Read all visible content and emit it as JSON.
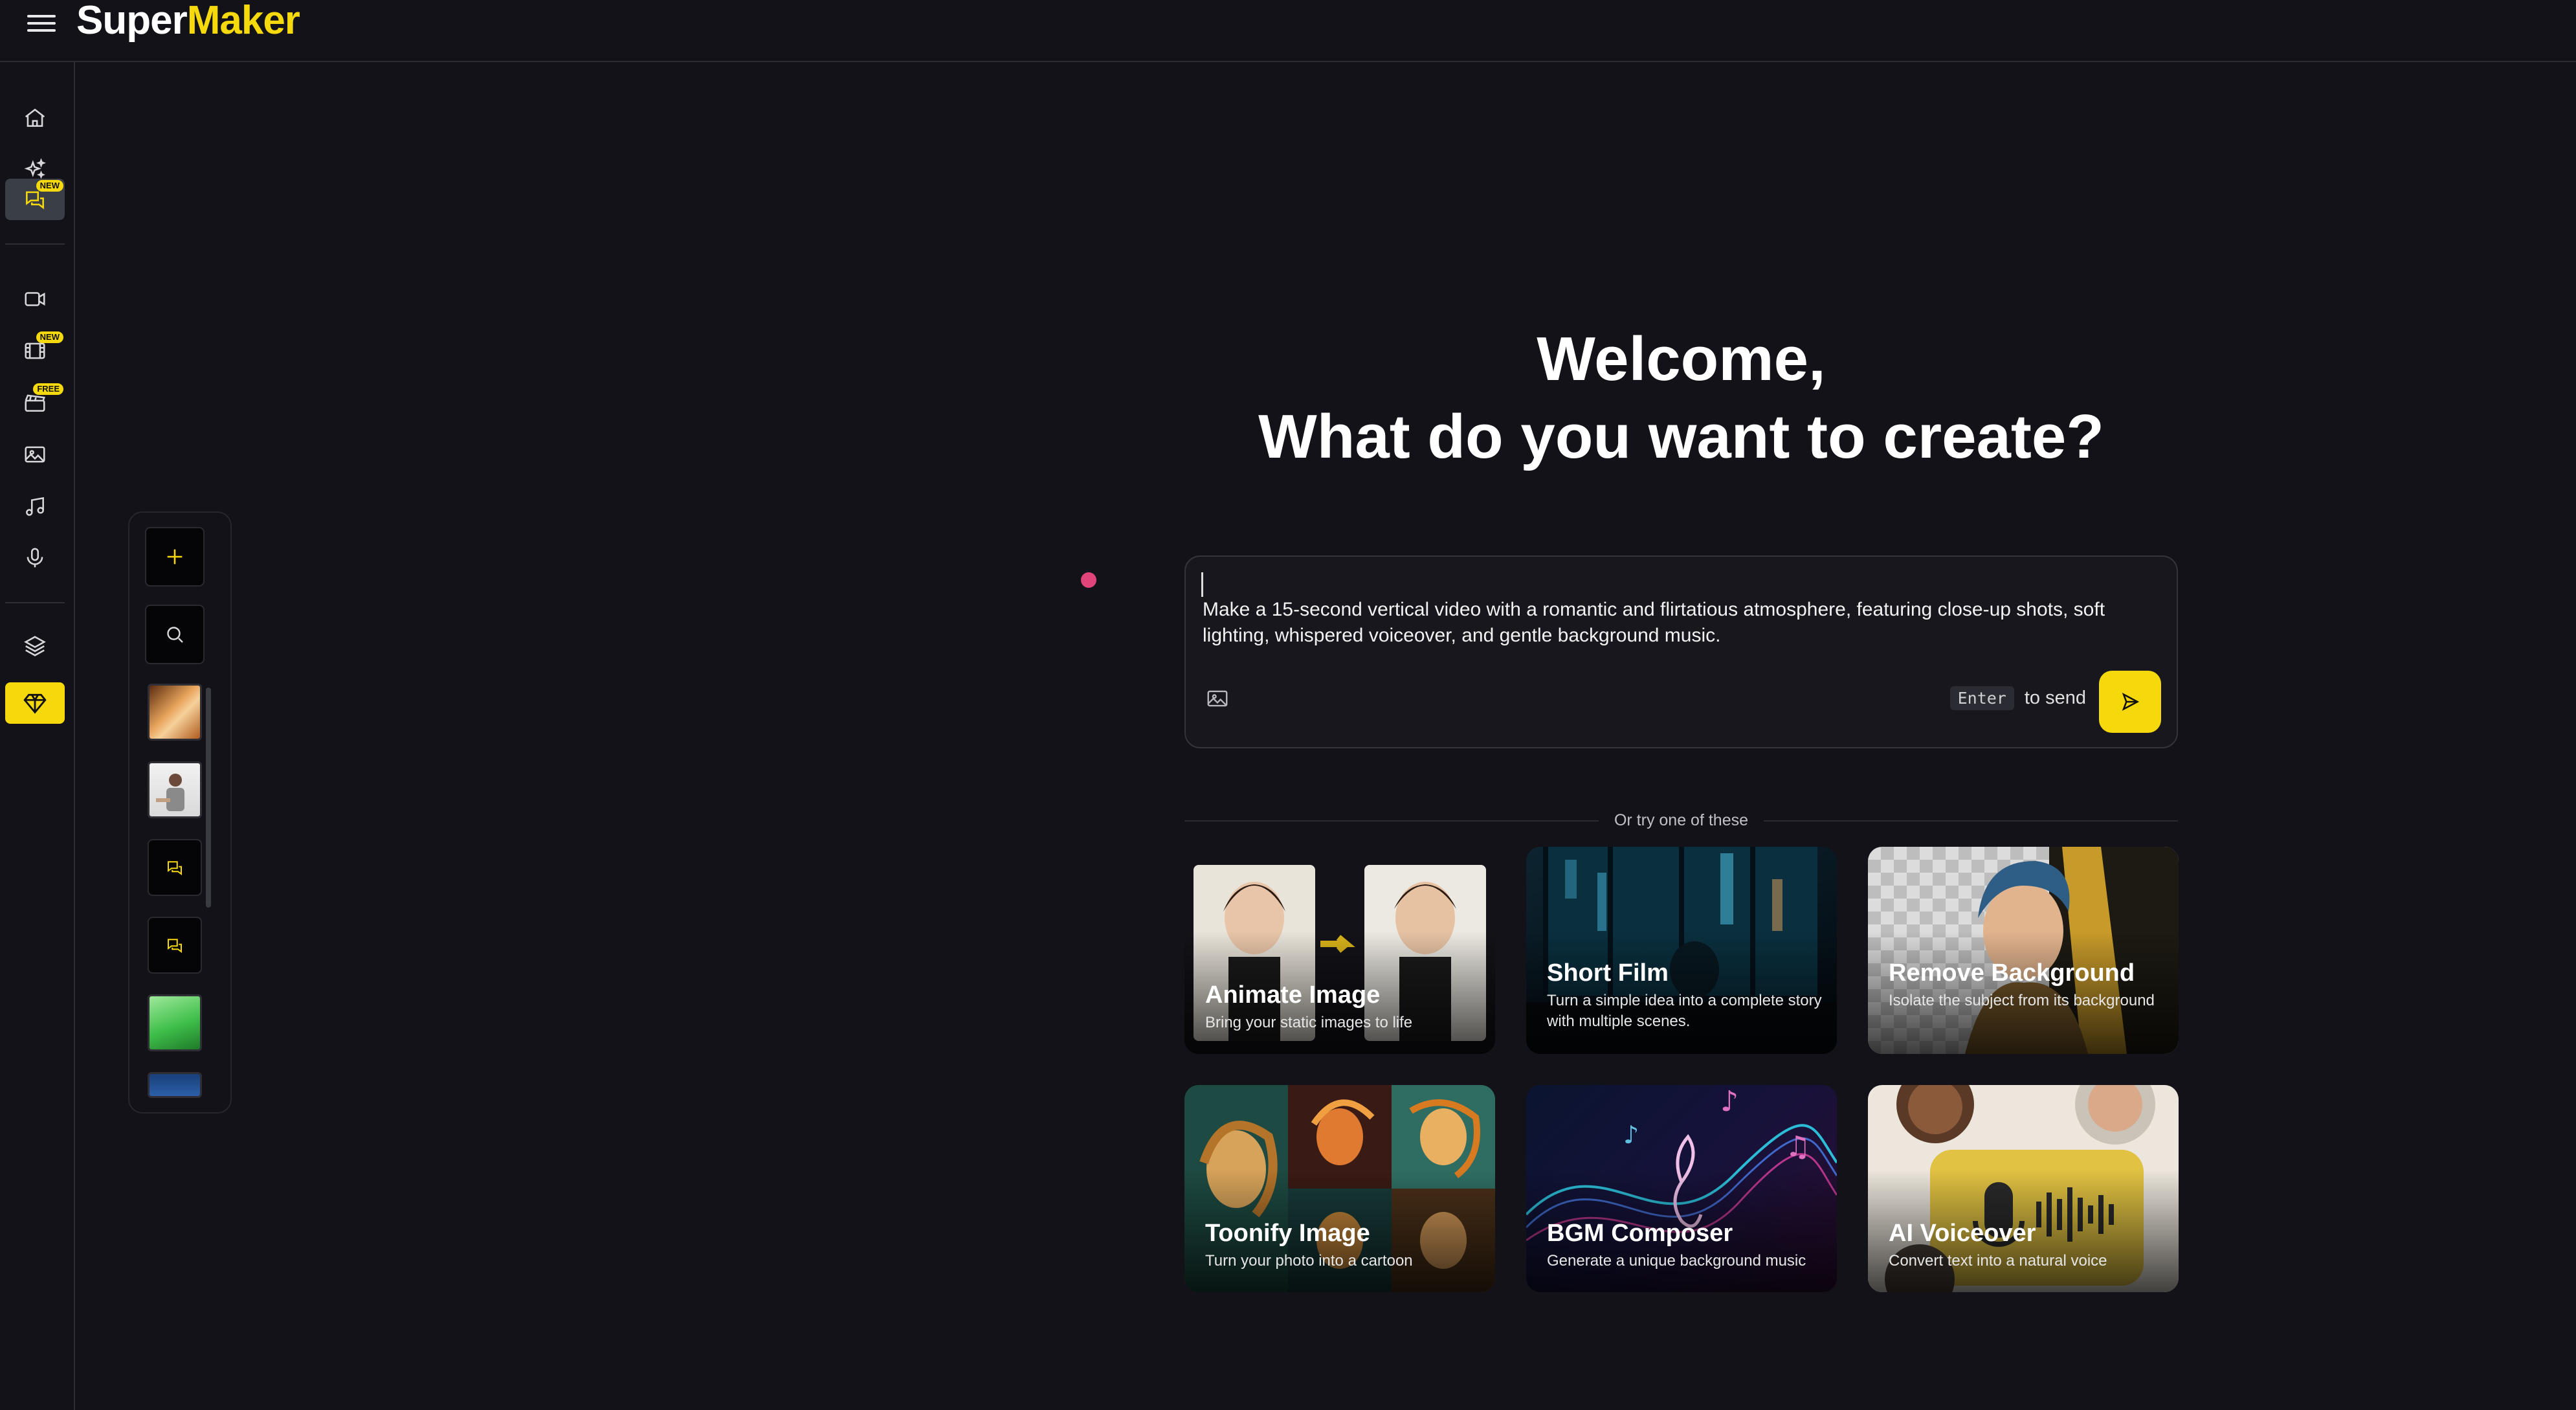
{
  "app": {
    "logo_part1": "Super",
    "logo_part2": "Maker"
  },
  "sidebar": {
    "items": [
      {
        "name": "home",
        "icon": "home-icon",
        "badge": ""
      },
      {
        "name": "ai-magic",
        "icon": "sparkles-icon",
        "badge": ""
      },
      {
        "name": "chat",
        "icon": "chat-icon",
        "badge": "NEW"
      },
      {
        "name": "video",
        "icon": "video-camera-icon",
        "badge": ""
      },
      {
        "name": "film",
        "icon": "film-icon",
        "badge": "NEW"
      },
      {
        "name": "clapper",
        "icon": "clapperboard-icon",
        "badge": "FREE"
      },
      {
        "name": "image",
        "icon": "image-icon",
        "badge": ""
      },
      {
        "name": "music",
        "icon": "music-note-icon",
        "badge": ""
      },
      {
        "name": "voice",
        "icon": "microphone-icon",
        "badge": ""
      },
      {
        "name": "layers",
        "icon": "layers-icon",
        "badge": ""
      },
      {
        "name": "premium",
        "icon": "diamond-icon",
        "badge": ""
      }
    ]
  },
  "welcome": {
    "line1": "Welcome,",
    "line2": "What do you want to create?"
  },
  "prompt": {
    "text": "Make a 15-second vertical video with a romantic and flirtatious atmosphere, featuring close-up shots, soft lighting, whispered voiceover, and gentle background music.",
    "enter_key": "Enter",
    "send_hint": "to send"
  },
  "suggestions": {
    "label": "Or try one of these",
    "cards": [
      {
        "title": "Animate Image",
        "desc": "Bring your static images to life"
      },
      {
        "title": "Short Film",
        "desc": "Turn a simple idea into a complete story with multiple scenes."
      },
      {
        "title": "Remove Background",
        "desc": "Isolate the subject from its background"
      },
      {
        "title": "Toonify Image",
        "desc": "Turn your photo into a cartoon"
      },
      {
        "title": "BGM Composer",
        "desc": "Generate a unique background music"
      },
      {
        "title": "AI Voiceover",
        "desc": "Convert text into a natural voice"
      }
    ]
  },
  "colors": {
    "accent": "#f5d90c",
    "background": "#121218",
    "cursor_dot": "#e0447a"
  }
}
